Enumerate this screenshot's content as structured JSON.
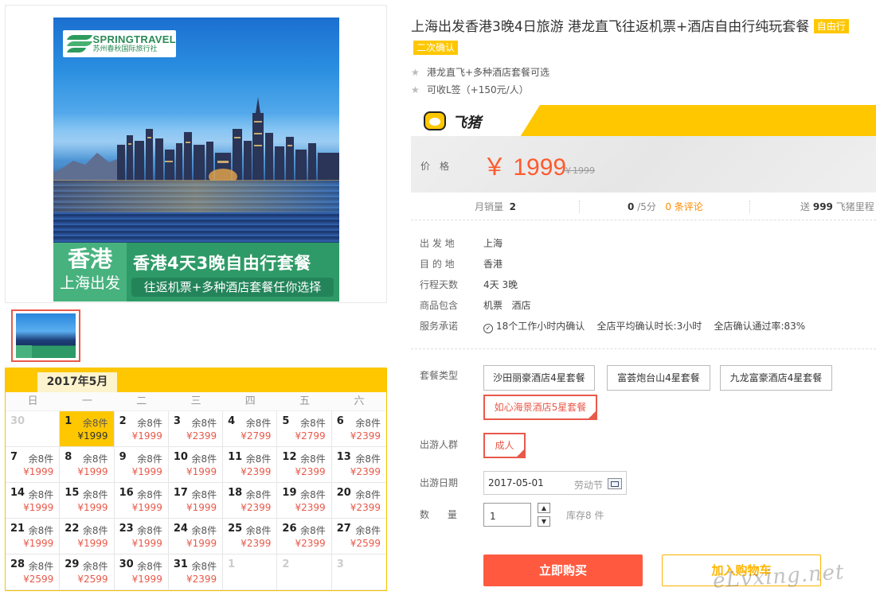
{
  "poster": {
    "brand_en": "SPRINGTRAVEL",
    "brand_cn": "苏州春秋国际旅行社",
    "city": "香港",
    "from": "上海出发",
    "headline": "香港4天3晚自由行套餐",
    "subline": "往返机票+多种酒店套餐任你选择"
  },
  "calendar": {
    "month": "2017年5月",
    "weekdays": [
      "日",
      "一",
      "二",
      "三",
      "四",
      "五",
      "六"
    ],
    "cells": [
      {
        "d": "30",
        "r": "",
        "p": "",
        "mute": true
      },
      {
        "d": "1",
        "r": "余8件",
        "p": "¥1999",
        "sel": true
      },
      {
        "d": "2",
        "r": "余8件",
        "p": "¥1999"
      },
      {
        "d": "3",
        "r": "余8件",
        "p": "¥2399"
      },
      {
        "d": "4",
        "r": "余8件",
        "p": "¥2799"
      },
      {
        "d": "5",
        "r": "余8件",
        "p": "¥2799"
      },
      {
        "d": "6",
        "r": "余8件",
        "p": "¥2399"
      },
      {
        "d": "7",
        "r": "余8件",
        "p": "¥1999"
      },
      {
        "d": "8",
        "r": "余8件",
        "p": "¥1999"
      },
      {
        "d": "9",
        "r": "余8件",
        "p": "¥1999"
      },
      {
        "d": "10",
        "r": "余8件",
        "p": "¥1999"
      },
      {
        "d": "11",
        "r": "余8件",
        "p": "¥2399"
      },
      {
        "d": "12",
        "r": "余8件",
        "p": "¥2399"
      },
      {
        "d": "13",
        "r": "余8件",
        "p": "¥2399"
      },
      {
        "d": "14",
        "r": "余8件",
        "p": "¥1999"
      },
      {
        "d": "15",
        "r": "余8件",
        "p": "¥1999"
      },
      {
        "d": "16",
        "r": "余8件",
        "p": "¥1999"
      },
      {
        "d": "17",
        "r": "余8件",
        "p": "¥1999"
      },
      {
        "d": "18",
        "r": "余8件",
        "p": "¥2399"
      },
      {
        "d": "19",
        "r": "余8件",
        "p": "¥2399"
      },
      {
        "d": "20",
        "r": "余8件",
        "p": "¥2399"
      },
      {
        "d": "21",
        "r": "余8件",
        "p": "¥1999"
      },
      {
        "d": "22",
        "r": "余8件",
        "p": "¥1999"
      },
      {
        "d": "23",
        "r": "余8件",
        "p": "¥1999"
      },
      {
        "d": "24",
        "r": "余8件",
        "p": "¥1999"
      },
      {
        "d": "25",
        "r": "余8件",
        "p": "¥2399"
      },
      {
        "d": "26",
        "r": "余8件",
        "p": "¥2399"
      },
      {
        "d": "27",
        "r": "余8件",
        "p": "¥2599"
      },
      {
        "d": "28",
        "r": "余8件",
        "p": "¥2599"
      },
      {
        "d": "29",
        "r": "余8件",
        "p": "¥2599"
      },
      {
        "d": "30",
        "r": "余8件",
        "p": "¥1999"
      },
      {
        "d": "31",
        "r": "余8件",
        "p": "¥2399"
      },
      {
        "d": "1",
        "r": "",
        "p": "",
        "mute": true
      },
      {
        "d": "2",
        "r": "",
        "p": "",
        "mute": true
      },
      {
        "d": "3",
        "r": "",
        "p": "",
        "mute": true
      }
    ]
  },
  "product": {
    "title": "上海出发香港3晚4日旅游 港龙直飞往返机票+酒店自由行纯玩套餐",
    "tag_free": "自由行",
    "tag_confirm": "二次确认",
    "features": [
      "港龙直飞+多种酒店套餐可选",
      "可收L签（+150元/人）"
    ]
  },
  "fliggy": {
    "name": "飞猪"
  },
  "price": {
    "label": "价格",
    "value": "￥ 1999",
    "original": "￥1999"
  },
  "stats": {
    "sales_label": "月销量",
    "sales": "2",
    "score": "0",
    "score_unit": "/5分",
    "reviews": "0 条评论",
    "gift_prefix": "送",
    "miles": "999",
    "miles_unit": "飞猪里程"
  },
  "info": [
    {
      "k": "出 发 地",
      "v": "上海"
    },
    {
      "k": "目 的 地",
      "v": "香港"
    },
    {
      "k": "行程天数",
      "v": "4天 3晚"
    },
    {
      "k": "商品包含",
      "v": "机票   酒店"
    },
    {
      "k": "服务承诺",
      "v": "18个工作小时内确认    全店平均确认时长:3小时    全店确认通过率:83%"
    }
  ],
  "options": {
    "package_label": "套餐类型",
    "packages": [
      "沙田丽豪酒店4星套餐",
      "富荟炮台山4星套餐",
      "九龙富豪酒店4星套餐",
      "如心海景酒店5星套餐"
    ],
    "crowd_label": "出游人群",
    "crowd": "成人",
    "date_label": "出游日期",
    "date": "2017-05-01",
    "holiday": "劳动节",
    "qty_label": "数      量",
    "qty": "1",
    "stock": "库存8 件"
  },
  "actions": {
    "buy": "立即购买",
    "cart": "加入购物车"
  },
  "watermark": "eLvxing.net",
  "colors": {
    "accent": "#ffc700",
    "price": "#ff5a2e",
    "buy": "#ff5a40",
    "selected": "#e8594a"
  }
}
